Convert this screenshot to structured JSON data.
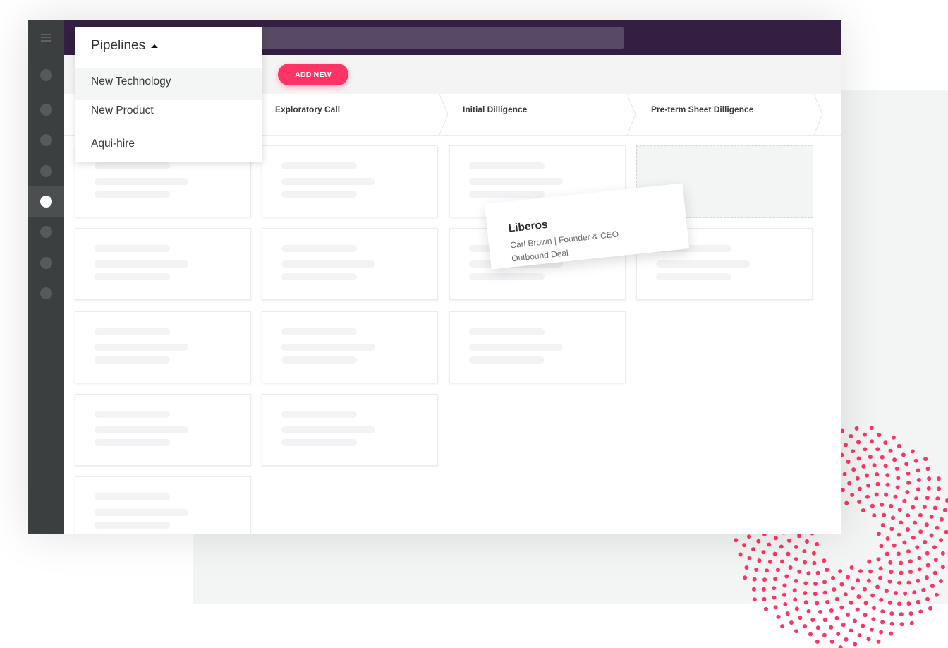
{
  "pipelines_dropdown": {
    "title": "Pipelines",
    "expanded": true,
    "items": [
      {
        "label": "New Technology",
        "hovered": true
      },
      {
        "label": "New Product",
        "hovered": false
      },
      {
        "label": "Aqui-hire",
        "hovered": false
      }
    ]
  },
  "toolbar": {
    "add_new_label": "ADD NEW"
  },
  "search": {
    "placeholder": ""
  },
  "sidebar": {
    "menu_icon": "hamburger-menu-icon",
    "items": [
      {
        "icon": "nav-dot-icon",
        "active": false
      },
      {
        "icon": "nav-dot-icon",
        "active": false
      },
      {
        "icon": "nav-dot-icon",
        "active": false
      },
      {
        "icon": "nav-dot-icon",
        "active": false
      },
      {
        "icon": "nav-dot-icon",
        "active": true
      },
      {
        "icon": "nav-dot-icon",
        "active": false
      },
      {
        "icon": "nav-dot-icon",
        "active": false
      },
      {
        "icon": "nav-dot-icon",
        "active": false
      }
    ]
  },
  "stages": [
    {
      "label": "",
      "card_count": 5
    },
    {
      "label": "Exploratory Call",
      "card_count": 4
    },
    {
      "label": "Initial Dilligence",
      "card_count": 3
    },
    {
      "label": "Pre-term Sheet Dilligence",
      "card_count": 1
    }
  ],
  "dragged_card": {
    "company": "Liberos",
    "contact": "Carl Brown | Founder & CEO",
    "source": "Outbound Deal"
  },
  "colors": {
    "topbar": "#341f42",
    "sidebar": "#3b3f40",
    "accent": "#fe3466",
    "dots": "#fe3466"
  }
}
